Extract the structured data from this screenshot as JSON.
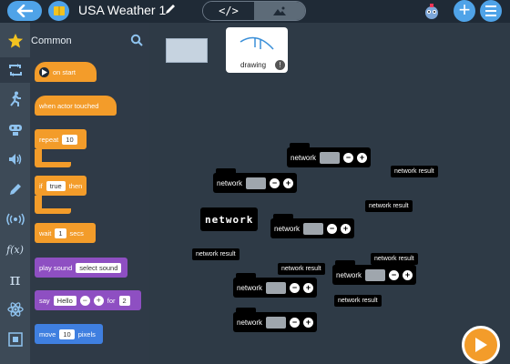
{
  "header": {
    "project_title": "USA Weather 1",
    "code_toggle_label": "</>"
  },
  "palette": {
    "category_title": "Common",
    "blocks": {
      "on_start": "on start",
      "when_touched": "when actor touched",
      "repeat_label": "repeat",
      "repeat_value": "10",
      "if_label": "if",
      "if_value": "true",
      "if_then": "then",
      "wait_label": "wait",
      "wait_value": "1",
      "wait_unit": "secs",
      "play_sound_label": "play sound",
      "play_sound_value": "select sound",
      "say_label": "say",
      "say_value": "Hello",
      "say_for": "for",
      "say_secs": "2",
      "move_label": "move",
      "move_value": "10",
      "move_unit": "pixels"
    }
  },
  "canvas": {
    "sprite_name": "drawing",
    "network_label": "network",
    "network_result": "network result",
    "network_stylized": "network"
  },
  "colors": {
    "accent": "#4fa3e8",
    "orange": "#f39c2a",
    "purple": "#8e4fc2",
    "blue": "#3f7fe0"
  }
}
